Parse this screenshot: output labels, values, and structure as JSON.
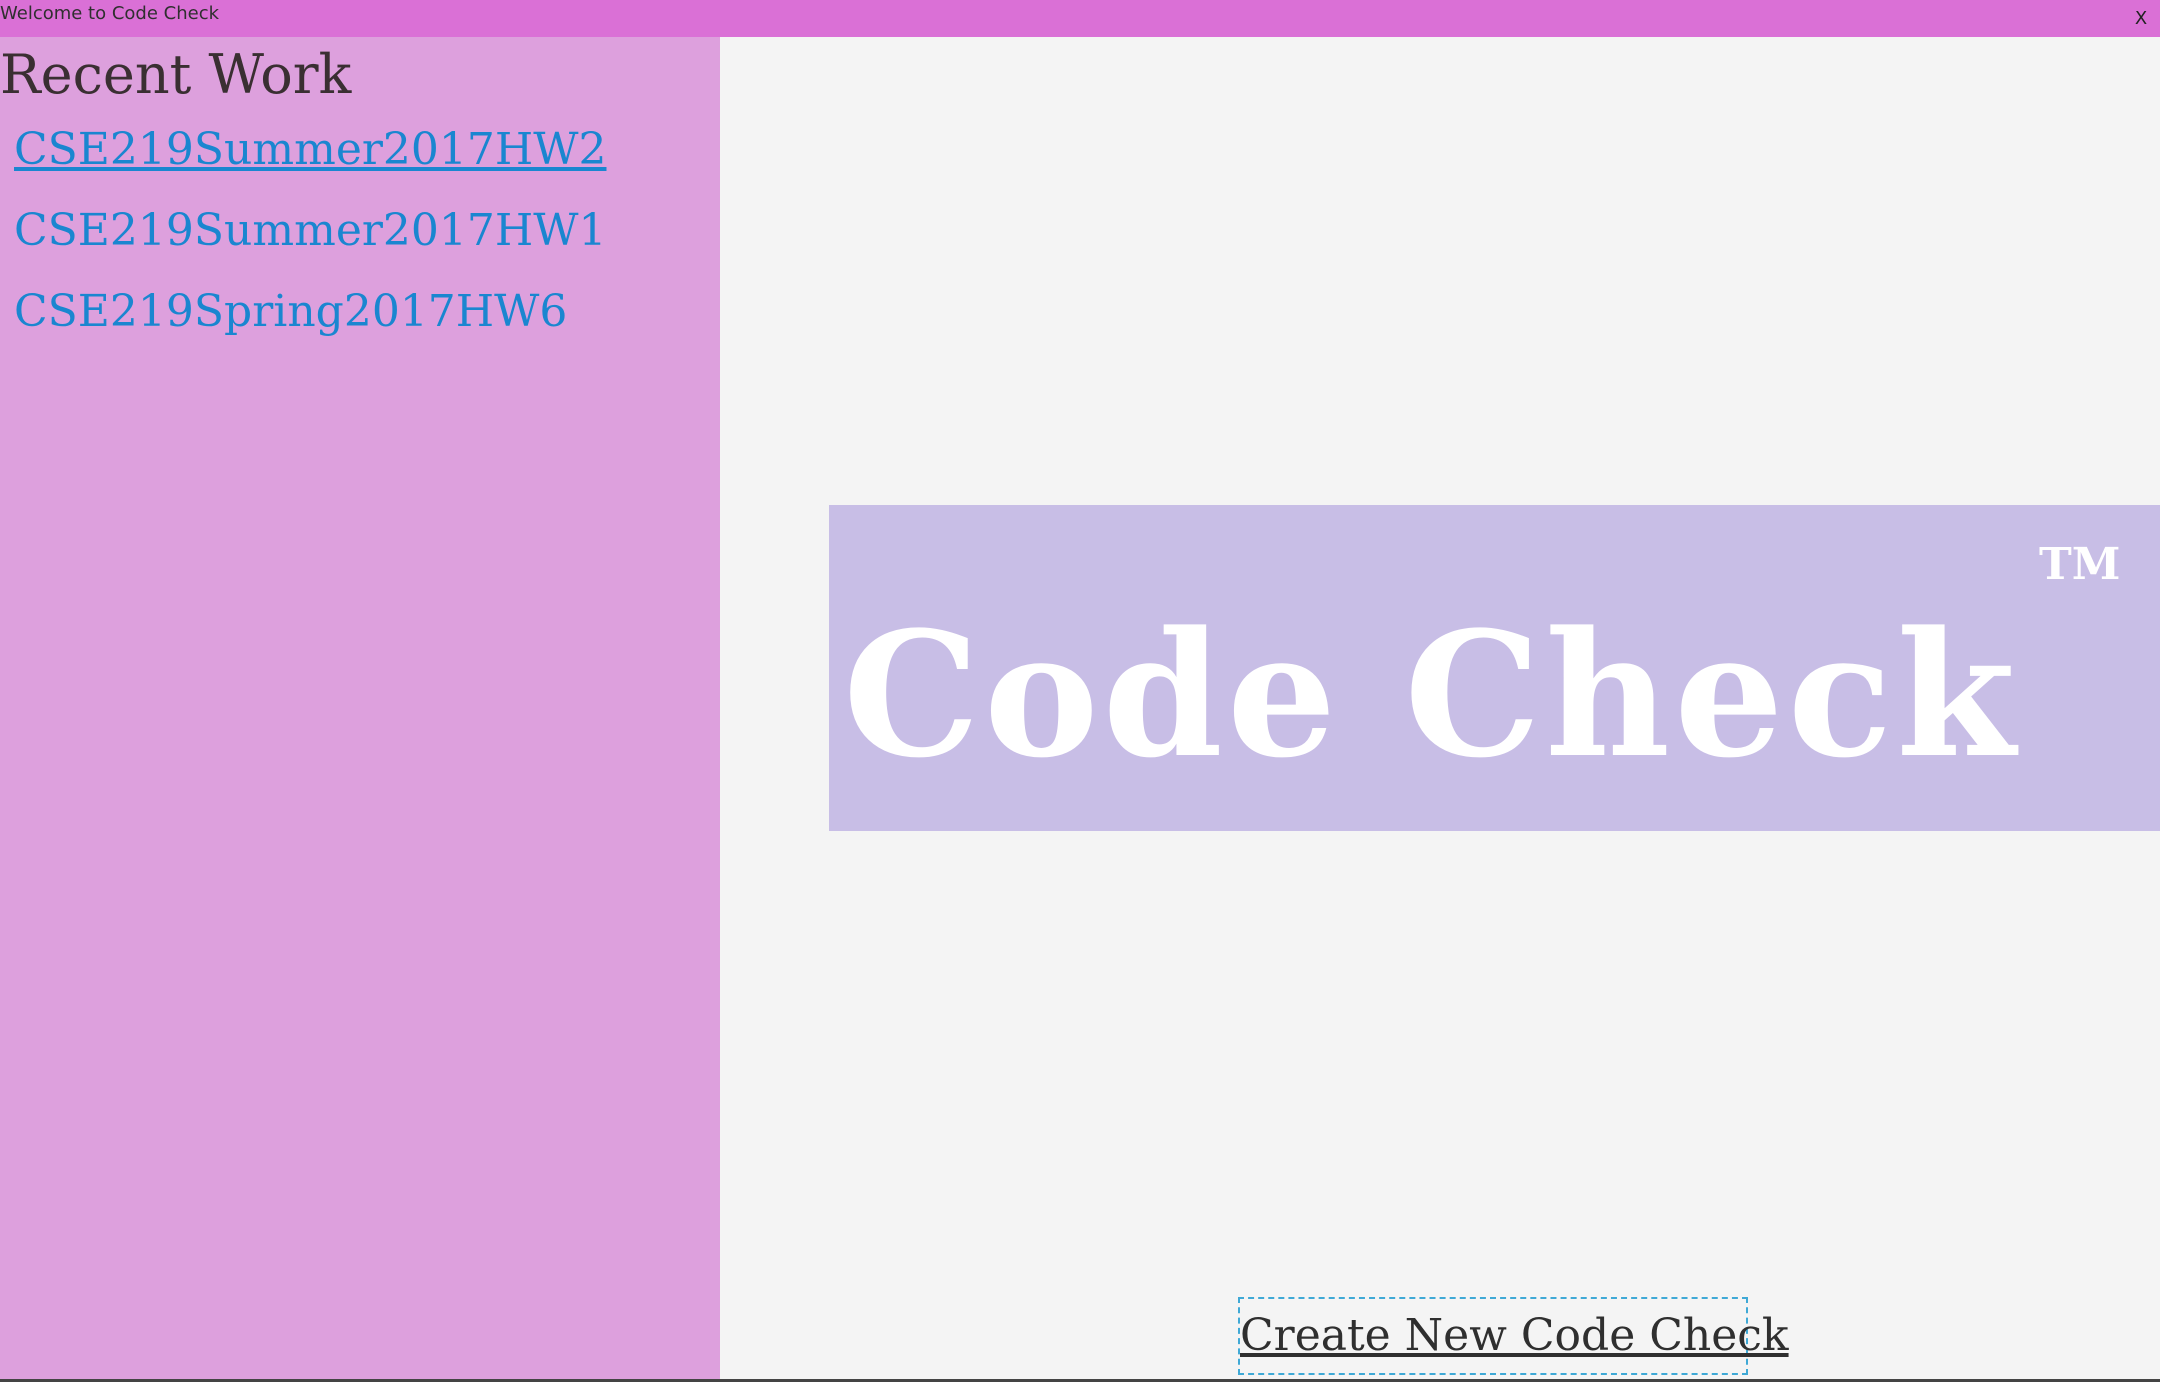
{
  "window": {
    "title": "Welcome to Code Check",
    "close_label": "X"
  },
  "sidebar": {
    "heading": "Recent Work",
    "items": [
      {
        "label": "CSE219Summer2017HW2"
      },
      {
        "label": "CSE219Summer2017HW1"
      },
      {
        "label": "CSE219Spring2017HW6"
      }
    ]
  },
  "logo": {
    "text": "Code Check",
    "trademark": "TM"
  },
  "main": {
    "create_label": "Create New Code Check"
  },
  "colors": {
    "titlebar": "#da70d6",
    "sidebar": "#dda0dd",
    "link": "#1a86d0",
    "logo_background": "#c8bee6",
    "main_background": "#f4f4f4"
  }
}
